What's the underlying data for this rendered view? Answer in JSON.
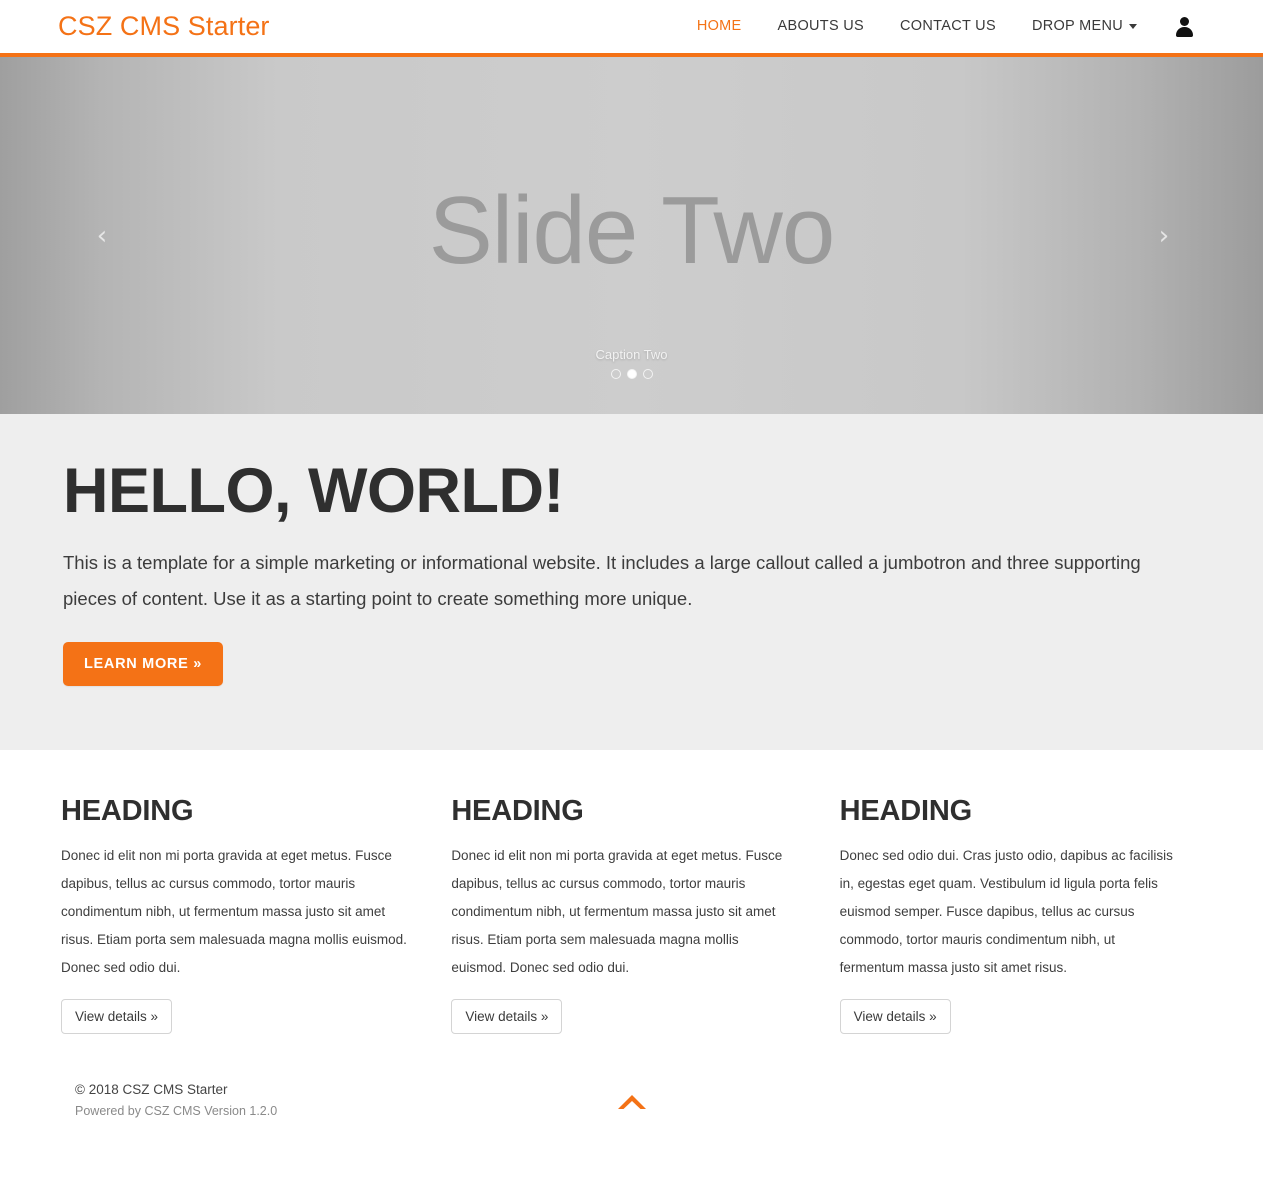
{
  "navbar": {
    "brand": "CSZ CMS Starter",
    "links": [
      {
        "label": "HOME",
        "active": true
      },
      {
        "label": "ABOUTS US",
        "active": false
      },
      {
        "label": "CONTACT US",
        "active": false
      },
      {
        "label": "DROP MENU",
        "active": false,
        "caret": true
      }
    ],
    "user_icon": "user-icon"
  },
  "carousel": {
    "slide_title": "Slide Two",
    "caption": "Caption Two",
    "prev_arrow": "‹",
    "next_arrow": "›",
    "indicator_count": 3,
    "active_indicator": 1
  },
  "jumbotron": {
    "title": "HELLO, WORLD!",
    "text": "This is a template for a simple marketing or informational website. It includes a large callout called a jumbotron and three supporting pieces of content. Use it as a starting point to create something more unique.",
    "button": "LEARN MORE »"
  },
  "columns": [
    {
      "heading": "HEADING",
      "body": "Donec id elit non mi porta gravida at eget metus. Fusce dapibus, tellus ac cursus commodo, tortor mauris condimentum nibh, ut fermentum massa justo sit amet risus. Etiam porta sem malesuada magna mollis euismod. Donec sed odio dui.",
      "button": "View details »"
    },
    {
      "heading": "HEADING",
      "body": "Donec id elit non mi porta gravida at eget metus. Fusce dapibus, tellus ac cursus commodo, tortor mauris condimentum nibh, ut fermentum massa justo sit amet risus. Etiam porta sem malesuada magna mollis euismod. Donec sed odio dui.",
      "button": "View details »"
    },
    {
      "heading": "HEADING",
      "body": "Donec sed odio dui. Cras justo odio, dapibus ac facilisis in, egestas eget quam. Vestibulum id ligula porta felis euismod semper. Fusce dapibus, tellus ac cursus commodo, tortor mauris condimentum nibh, ut fermentum massa justo sit amet risus.",
      "button": "View details »"
    }
  ],
  "footer": {
    "copyright": "© 2018 CSZ CMS Starter",
    "powered": "Powered by CSZ CMS Version 1.2.0",
    "to_top_icon": "chevron-up-icon"
  },
  "colors": {
    "accent": "#f47216",
    "jumbotron_bg": "#eeeeee",
    "text_dark": "#2f2f2f"
  }
}
